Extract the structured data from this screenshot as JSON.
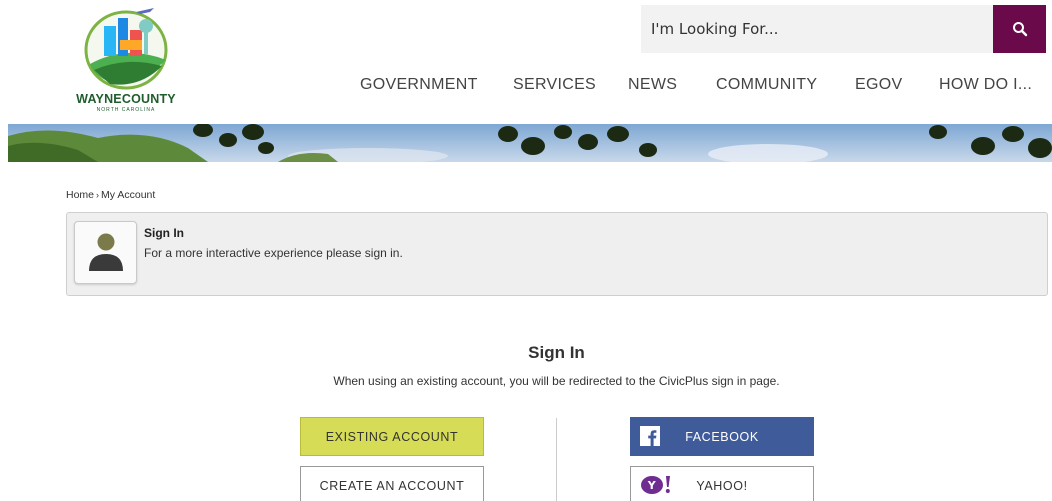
{
  "logo": {
    "name_part1": "WAYNE",
    "name_part2": "COUNTY",
    "subtitle": "NORTH CAROLINA"
  },
  "search": {
    "placeholder": "I'm Looking For...",
    "value": "",
    "icon": "search-icon"
  },
  "nav": {
    "items": [
      {
        "label": "GOVERNMENT"
      },
      {
        "label": "SERVICES"
      },
      {
        "label": "NEWS"
      },
      {
        "label": "COMMUNITY"
      },
      {
        "label": "EGOV"
      },
      {
        "label": "HOW DO I..."
      }
    ]
  },
  "breadcrumb": {
    "home": "Home",
    "separator": "›",
    "current": "My Account"
  },
  "info_box": {
    "title": "Sign In",
    "text": "For a more interactive experience please sign in.",
    "icon": "user-icon"
  },
  "signin": {
    "title": "Sign In",
    "description": "When using an existing account, you will be redirected to the CivicPlus sign in page.",
    "buttons": {
      "existing": "EXISTING ACCOUNT",
      "create": "CREATE AN ACCOUNT",
      "facebook": "FACEBOOK",
      "yahoo": "YAHOO!"
    }
  },
  "colors": {
    "search_button": "#6b0a4b",
    "existing_button": "#d7dc57",
    "facebook_button": "#3f5b9a",
    "yahoo_purple": "#6f2c91",
    "logo_green": "#1f5d2d"
  }
}
